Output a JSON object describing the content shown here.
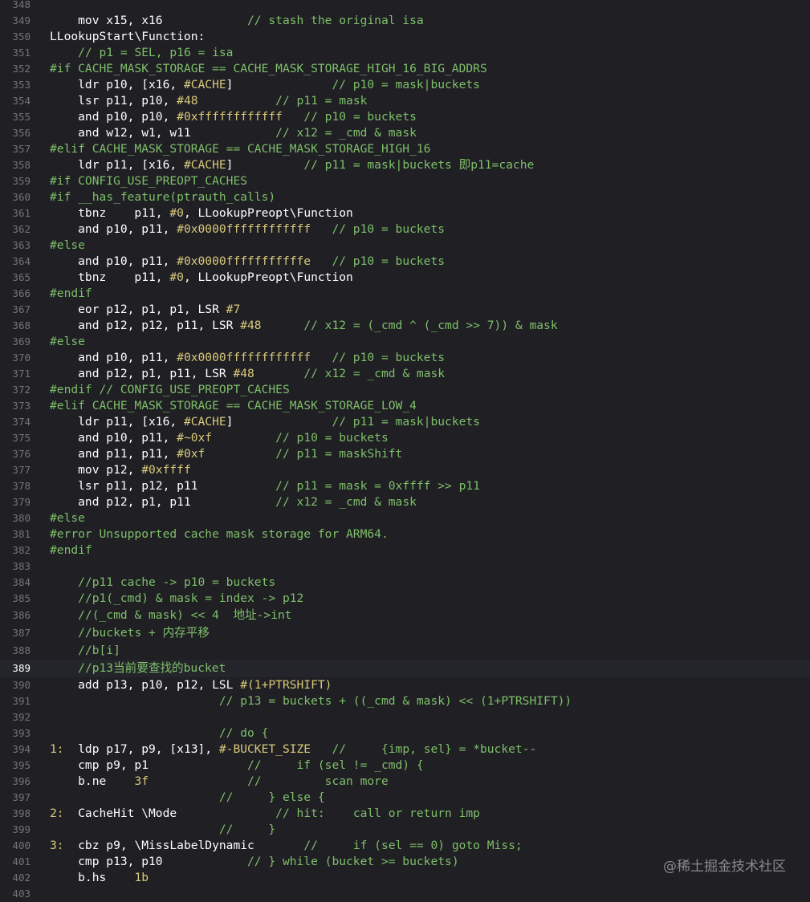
{
  "editor": {
    "current_line": "389",
    "lines": [
      {
        "n": "348",
        "text": ""
      },
      {
        "n": "349",
        "text": "    mov x15, x16            // stash the original isa"
      },
      {
        "n": "350",
        "text": "LLookupStart\\Function:"
      },
      {
        "n": "351",
        "text": "    // p1 = SEL, p16 = isa"
      },
      {
        "n": "352",
        "text": "#if CACHE_MASK_STORAGE == CACHE_MASK_STORAGE_HIGH_16_BIG_ADDRS"
      },
      {
        "n": "353",
        "text": "    ldr p10, [x16, #CACHE]              // p10 = mask|buckets"
      },
      {
        "n": "354",
        "text": "    lsr p11, p10, #48           // p11 = mask"
      },
      {
        "n": "355",
        "text": "    and p10, p10, #0xffffffffffff   // p10 = buckets"
      },
      {
        "n": "356",
        "text": "    and w12, w1, w11            // x12 = _cmd & mask"
      },
      {
        "n": "357",
        "text": "#elif CACHE_MASK_STORAGE == CACHE_MASK_STORAGE_HIGH_16"
      },
      {
        "n": "358",
        "text": "    ldr p11, [x16, #CACHE]          // p11 = mask|buckets 即p11=cache"
      },
      {
        "n": "359",
        "text": "#if CONFIG_USE_PREOPT_CACHES"
      },
      {
        "n": "360",
        "text": "#if __has_feature(ptrauth_calls)"
      },
      {
        "n": "361",
        "text": "    tbnz    p11, #0, LLookupPreopt\\Function"
      },
      {
        "n": "362",
        "text": "    and p10, p11, #0x0000ffffffffffff   // p10 = buckets"
      },
      {
        "n": "363",
        "text": "#else"
      },
      {
        "n": "364",
        "text": "    and p10, p11, #0x0000fffffffffffe   // p10 = buckets"
      },
      {
        "n": "365",
        "text": "    tbnz    p11, #0, LLookupPreopt\\Function"
      },
      {
        "n": "366",
        "text": "#endif"
      },
      {
        "n": "367",
        "text": "    eor p12, p1, p1, LSR #7"
      },
      {
        "n": "368",
        "text": "    and p12, p12, p11, LSR #48      // x12 = (_cmd ^ (_cmd >> 7)) & mask"
      },
      {
        "n": "369",
        "text": "#else"
      },
      {
        "n": "370",
        "text": "    and p10, p11, #0x0000ffffffffffff   // p10 = buckets"
      },
      {
        "n": "371",
        "text": "    and p12, p1, p11, LSR #48       // x12 = _cmd & mask"
      },
      {
        "n": "372",
        "text": "#endif // CONFIG_USE_PREOPT_CACHES"
      },
      {
        "n": "373",
        "text": "#elif CACHE_MASK_STORAGE == CACHE_MASK_STORAGE_LOW_4"
      },
      {
        "n": "374",
        "text": "    ldr p11, [x16, #CACHE]              // p11 = mask|buckets"
      },
      {
        "n": "375",
        "text": "    and p10, p11, #~0xf         // p10 = buckets"
      },
      {
        "n": "376",
        "text": "    and p11, p11, #0xf          // p11 = maskShift"
      },
      {
        "n": "377",
        "text": "    mov p12, #0xffff"
      },
      {
        "n": "378",
        "text": "    lsr p11, p12, p11           // p11 = mask = 0xffff >> p11"
      },
      {
        "n": "379",
        "text": "    and p12, p1, p11            // x12 = _cmd & mask"
      },
      {
        "n": "380",
        "text": "#else"
      },
      {
        "n": "381",
        "text": "#error Unsupported cache mask storage for ARM64."
      },
      {
        "n": "382",
        "text": "#endif"
      },
      {
        "n": "383",
        "text": ""
      },
      {
        "n": "384",
        "text": "    //p11 cache -> p10 = buckets"
      },
      {
        "n": "385",
        "text": "    //p1(_cmd) & mask = index -> p12"
      },
      {
        "n": "386",
        "text": "    //(_cmd & mask) << 4  地址->int"
      },
      {
        "n": "387",
        "text": "    //buckets + 内存平移"
      },
      {
        "n": "388",
        "text": "    //b[i]"
      },
      {
        "n": "389",
        "text": "    //p13当前要查找的bucket"
      },
      {
        "n": "390",
        "text": "    add p13, p10, p12, LSL #(1+PTRSHIFT)"
      },
      {
        "n": "391",
        "text": "                        // p13 = buckets + ((_cmd & mask) << (1+PTRSHIFT))"
      },
      {
        "n": "392",
        "text": ""
      },
      {
        "n": "393",
        "text": "                        // do {"
      },
      {
        "n": "394",
        "text": "1:  ldp p17, p9, [x13], #-BUCKET_SIZE   //     {imp, sel} = *bucket--"
      },
      {
        "n": "395",
        "text": "    cmp p9, p1              //     if (sel != _cmd) {"
      },
      {
        "n": "396",
        "text": "    b.ne    3f              //         scan more"
      },
      {
        "n": "397",
        "text": "                        //     } else {"
      },
      {
        "n": "398",
        "text": "2:  CacheHit \\Mode              // hit:    call or return imp"
      },
      {
        "n": "399",
        "text": "                        //     }"
      },
      {
        "n": "400",
        "text": "3:  cbz p9, \\MissLabelDynamic       //     if (sel == 0) goto Miss;"
      },
      {
        "n": "401",
        "text": "    cmp p13, p10            // } while (bucket >= buckets)"
      },
      {
        "n": "402",
        "text": "    b.hs    1b"
      },
      {
        "n": "403",
        "text": ""
      }
    ]
  },
  "watermark": "@稀土掘金技术社区"
}
